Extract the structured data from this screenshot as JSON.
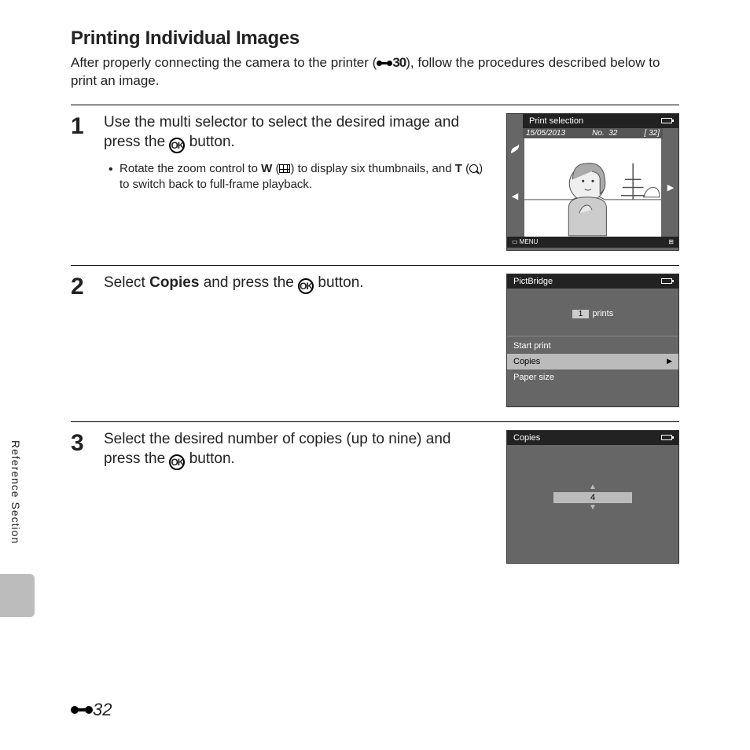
{
  "title": "Printing Individual Images",
  "intro_pre": "After properly connecting the camera to the printer (",
  "intro_ref": "30",
  "intro_post": "), follow the procedures described below to print an image.",
  "steps": {
    "s1": {
      "num": "1",
      "instr_pre": "Use the multi selector to select the desired image and press the ",
      "instr_post": " button.",
      "bullet": "Rotate the zoom control to W ( ) to display six thumbnails, and T ( ) to switch back to full-frame playback.",
      "ok": "OK"
    },
    "s2": {
      "num": "2",
      "instr_pre": "Select ",
      "instr_bold": "Copies",
      "instr_mid": " and press the ",
      "instr_post": " button.",
      "ok": "OK"
    },
    "s3": {
      "num": "3",
      "instr_pre": "Select the desired number of copies (up to nine) and press the ",
      "instr_post": " button.",
      "ok": "OK"
    }
  },
  "lcd1": {
    "header": "Print selection",
    "date": "15/05/2013",
    "no_lbl": "No.",
    "no_val": "32",
    "total": "[    32]",
    "menu": "MENU"
  },
  "lcd2": {
    "header": "PictBridge",
    "count": "1",
    "prints": "prints",
    "items": [
      "Start print",
      "Copies",
      "Paper size"
    ],
    "selected": 1
  },
  "lcd3": {
    "header": "Copies",
    "value": "4"
  },
  "side_label": "Reference Section",
  "page_number": "32"
}
